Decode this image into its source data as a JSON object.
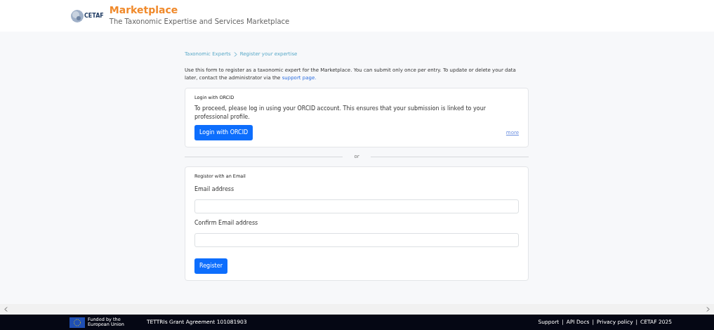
{
  "header": {
    "logo_text": "CETAF",
    "title": "Marketplace",
    "subtitle": "The Taxonomic Expertise and Services Marketplace"
  },
  "breadcrumb": [
    {
      "label": "Taxonomic Experts"
    },
    {
      "label": "Register your expertise"
    }
  ],
  "intro": {
    "text": "Use this form to register as a taxonomic expert for the Marketplace. You can submit only once per entry. To update or delete your data later, contact the administrator via the ",
    "link": "support page."
  },
  "orcid_card": {
    "title": "Login with ORCID",
    "text": "To proceed, please log in using your ORCID account. This ensures that your submission is linked to your professional profile.",
    "button": "Login with ORCID",
    "more_link": "more"
  },
  "divider": "or",
  "email_card": {
    "title": "Register with an Email",
    "fields": [
      {
        "label": "Email address"
      },
      {
        "label": "Confirm Email address"
      }
    ],
    "button": "Register"
  },
  "footer": {
    "funding": "Funded by the European Union",
    "grant": "TETTRIs Grant Agreement 101081903",
    "separator": "|",
    "links": [
      "Support",
      "API Docs",
      "Privacy policy",
      "CETAF 2025"
    ]
  }
}
